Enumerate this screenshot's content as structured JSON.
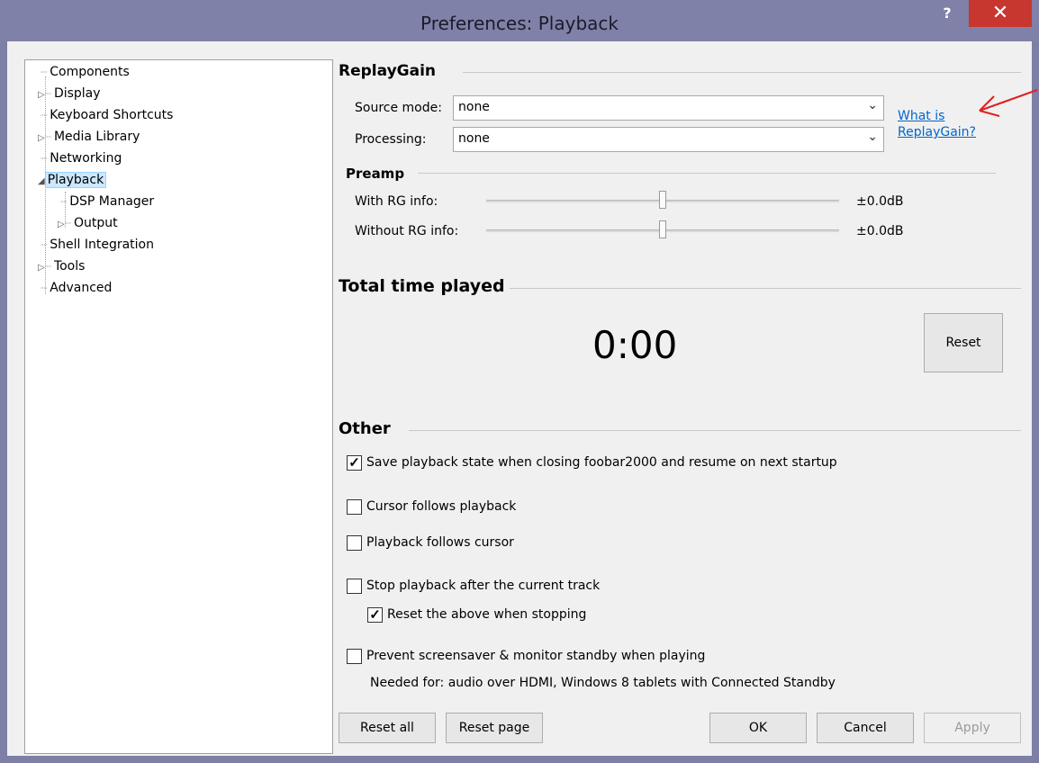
{
  "window": {
    "title": "Preferences: Playback",
    "help_label": "?",
    "close_label": "✕"
  },
  "tree": {
    "items": [
      {
        "label": "Components",
        "expander": ""
      },
      {
        "label": "Display",
        "expander": "▷"
      },
      {
        "label": "Keyboard Shortcuts",
        "expander": ""
      },
      {
        "label": "Media Library",
        "expander": "▷"
      },
      {
        "label": "Networking",
        "expander": ""
      },
      {
        "label": "Playback",
        "expander": "◢",
        "selected": true
      },
      {
        "label": "DSP Manager",
        "expander": ""
      },
      {
        "label": "Output",
        "expander": "▷"
      },
      {
        "label": "Shell Integration",
        "expander": ""
      },
      {
        "label": "Tools",
        "expander": "▷"
      },
      {
        "label": "Advanced",
        "expander": ""
      }
    ]
  },
  "replaygain": {
    "title": "ReplayGain",
    "source_mode_label": "Source mode:",
    "source_mode_value": "none",
    "processing_label": "Processing:",
    "processing_value": "none",
    "link_line1": "What is",
    "link_line2": "ReplayGain?"
  },
  "preamp": {
    "title": "Preamp",
    "with_label": "With RG info:",
    "with_value": "±0.0dB",
    "with_level": 0.5,
    "without_label": "Without RG info:",
    "without_value": "±0.0dB",
    "without_level": 0.5
  },
  "total_time": {
    "title": "Total time played",
    "value": "0:00",
    "reset_label": "Reset"
  },
  "other": {
    "title": "Other",
    "options": [
      {
        "label": "Save playback state when closing foobar2000 and resume on next startup",
        "checked": true
      },
      {
        "label": "Cursor follows playback",
        "checked": false
      },
      {
        "label": "Playback follows cursor",
        "checked": false
      },
      {
        "label": "Stop playback after the current track",
        "checked": false
      },
      {
        "label": "Reset the above when stopping",
        "checked": true
      },
      {
        "label": "Prevent screensaver & monitor standby when playing",
        "checked": false
      }
    ],
    "note": "Needed for: audio over HDMI, Windows 8 tablets with Connected Standby"
  },
  "buttons": {
    "reset_all": "Reset all",
    "reset_page": "Reset page",
    "ok": "OK",
    "cancel": "Cancel",
    "apply": "Apply"
  },
  "colors": {
    "title_bar": "#8081a8",
    "close_button": "#c7372f",
    "link": "#0066cc",
    "annotation_arrow": "#e02020"
  }
}
